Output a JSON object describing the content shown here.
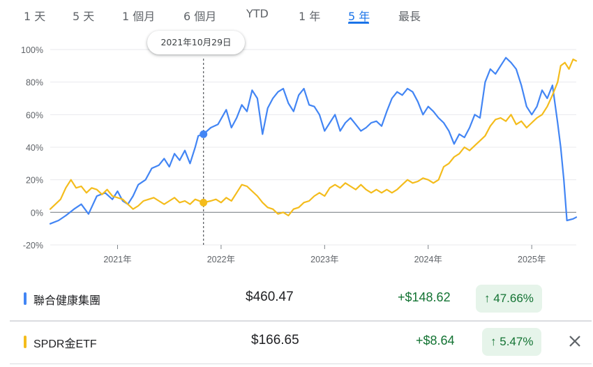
{
  "tabs": [
    {
      "label": "1 天",
      "active": false
    },
    {
      "label": "5 天",
      "active": false
    },
    {
      "label": "1 個月",
      "active": false
    },
    {
      "label": "6 個月",
      "active": false
    },
    {
      "label": "YTD",
      "active": false
    },
    {
      "label": "1 年",
      "active": false
    },
    {
      "label": "5 年",
      "active": true
    },
    {
      "label": "最長",
      "active": false
    }
  ],
  "tooltip_date": "2021年10月29日",
  "colors": {
    "series_a": "#4285f4",
    "series_b": "#f4bc1c",
    "accent": "#1a73e8",
    "gain": "#137333",
    "pill_bg": "#e6f4ea"
  },
  "chart_data": {
    "type": "line",
    "y_ticks": [
      "100%",
      "80%",
      "60%",
      "40%",
      "20%",
      "0%",
      "-20%"
    ],
    "ylim": [
      -20,
      100
    ],
    "x_ticks": [
      "2021年",
      "2022年",
      "2023年",
      "2024年",
      "2025年"
    ],
    "xlim": [
      2020.35,
      2025.43
    ],
    "grid": true,
    "hover_marker": {
      "x": 2021.83,
      "values": [
        48,
        6
      ]
    },
    "series": [
      {
        "color": "#4285f4",
        "points": [
          [
            2020.35,
            -7
          ],
          [
            2020.43,
            -5
          ],
          [
            2020.5,
            -2
          ],
          [
            2020.58,
            2
          ],
          [
            2020.65,
            5
          ],
          [
            2020.72,
            -1
          ],
          [
            2020.8,
            10
          ],
          [
            2020.88,
            12
          ],
          [
            2020.95,
            8
          ],
          [
            2021.0,
            13
          ],
          [
            2021.05,
            7
          ],
          [
            2021.1,
            5
          ],
          [
            2021.15,
            10
          ],
          [
            2021.2,
            17
          ],
          [
            2021.27,
            20
          ],
          [
            2021.33,
            27
          ],
          [
            2021.4,
            29
          ],
          [
            2021.45,
            33
          ],
          [
            2021.5,
            28
          ],
          [
            2021.55,
            36
          ],
          [
            2021.6,
            32
          ],
          [
            2021.65,
            38
          ],
          [
            2021.7,
            30
          ],
          [
            2021.75,
            40
          ],
          [
            2021.78,
            47
          ],
          [
            2021.83,
            48
          ],
          [
            2021.9,
            52
          ],
          [
            2021.97,
            54
          ],
          [
            2022.05,
            63
          ],
          [
            2022.1,
            52
          ],
          [
            2022.15,
            58
          ],
          [
            2022.2,
            66
          ],
          [
            2022.25,
            62
          ],
          [
            2022.3,
            75
          ],
          [
            2022.35,
            70
          ],
          [
            2022.4,
            48
          ],
          [
            2022.45,
            64
          ],
          [
            2022.5,
            70
          ],
          [
            2022.55,
            74
          ],
          [
            2022.6,
            76
          ],
          [
            2022.65,
            67
          ],
          [
            2022.7,
            62
          ],
          [
            2022.75,
            72
          ],
          [
            2022.8,
            76
          ],
          [
            2022.85,
            66
          ],
          [
            2022.9,
            65
          ],
          [
            2022.95,
            60
          ],
          [
            2023.0,
            50
          ],
          [
            2023.05,
            55
          ],
          [
            2023.1,
            60
          ],
          [
            2023.15,
            50
          ],
          [
            2023.2,
            55
          ],
          [
            2023.25,
            58
          ],
          [
            2023.3,
            54
          ],
          [
            2023.35,
            50
          ],
          [
            2023.4,
            52
          ],
          [
            2023.45,
            55
          ],
          [
            2023.5,
            56
          ],
          [
            2023.55,
            53
          ],
          [
            2023.6,
            62
          ],
          [
            2023.65,
            70
          ],
          [
            2023.7,
            74
          ],
          [
            2023.75,
            72
          ],
          [
            2023.8,
            76
          ],
          [
            2023.85,
            74
          ],
          [
            2023.9,
            68
          ],
          [
            2023.95,
            60
          ],
          [
            2024.0,
            65
          ],
          [
            2024.05,
            62
          ],
          [
            2024.1,
            58
          ],
          [
            2024.15,
            55
          ],
          [
            2024.2,
            50
          ],
          [
            2024.25,
            42
          ],
          [
            2024.3,
            48
          ],
          [
            2024.35,
            46
          ],
          [
            2024.4,
            52
          ],
          [
            2024.45,
            60
          ],
          [
            2024.5,
            58
          ],
          [
            2024.55,
            80
          ],
          [
            2024.6,
            88
          ],
          [
            2024.65,
            85
          ],
          [
            2024.7,
            90
          ],
          [
            2024.75,
            95
          ],
          [
            2024.8,
            92
          ],
          [
            2024.85,
            88
          ],
          [
            2024.9,
            78
          ],
          [
            2024.95,
            65
          ],
          [
            2025.0,
            60
          ],
          [
            2025.05,
            65
          ],
          [
            2025.1,
            75
          ],
          [
            2025.15,
            70
          ],
          [
            2025.2,
            78
          ],
          [
            2025.25,
            55
          ],
          [
            2025.28,
            40
          ],
          [
            2025.31,
            20
          ],
          [
            2025.34,
            -5
          ],
          [
            2025.4,
            -4
          ],
          [
            2025.43,
            -3
          ]
        ]
      },
      {
        "color": "#f4bc1c",
        "points": [
          [
            2020.35,
            2
          ],
          [
            2020.45,
            8
          ],
          [
            2020.5,
            15
          ],
          [
            2020.55,
            20
          ],
          [
            2020.6,
            15
          ],
          [
            2020.65,
            16
          ],
          [
            2020.7,
            12
          ],
          [
            2020.75,
            15
          ],
          [
            2020.8,
            14
          ],
          [
            2020.85,
            11
          ],
          [
            2020.9,
            14
          ],
          [
            2020.95,
            10
          ],
          [
            2021.0,
            9
          ],
          [
            2021.05,
            8
          ],
          [
            2021.1,
            5
          ],
          [
            2021.15,
            2
          ],
          [
            2021.2,
            4
          ],
          [
            2021.25,
            7
          ],
          [
            2021.3,
            8
          ],
          [
            2021.35,
            9
          ],
          [
            2021.4,
            7
          ],
          [
            2021.45,
            5
          ],
          [
            2021.5,
            7
          ],
          [
            2021.55,
            9
          ],
          [
            2021.6,
            6
          ],
          [
            2021.65,
            7
          ],
          [
            2021.7,
            5
          ],
          [
            2021.75,
            8
          ],
          [
            2021.83,
            6
          ],
          [
            2021.9,
            7
          ],
          [
            2021.95,
            8
          ],
          [
            2022.0,
            6
          ],
          [
            2022.05,
            9
          ],
          [
            2022.1,
            7
          ],
          [
            2022.15,
            12
          ],
          [
            2022.2,
            17
          ],
          [
            2022.25,
            16
          ],
          [
            2022.3,
            13
          ],
          [
            2022.35,
            10
          ],
          [
            2022.4,
            6
          ],
          [
            2022.45,
            3
          ],
          [
            2022.5,
            2
          ],
          [
            2022.55,
            -1
          ],
          [
            2022.6,
            0
          ],
          [
            2022.65,
            -2
          ],
          [
            2022.7,
            2
          ],
          [
            2022.75,
            3
          ],
          [
            2022.8,
            6
          ],
          [
            2022.85,
            7
          ],
          [
            2022.9,
            10
          ],
          [
            2022.95,
            12
          ],
          [
            2023.0,
            10
          ],
          [
            2023.05,
            15
          ],
          [
            2023.1,
            17
          ],
          [
            2023.15,
            15
          ],
          [
            2023.2,
            18
          ],
          [
            2023.25,
            16
          ],
          [
            2023.3,
            14
          ],
          [
            2023.35,
            17
          ],
          [
            2023.4,
            14
          ],
          [
            2023.45,
            12
          ],
          [
            2023.5,
            14
          ],
          [
            2023.55,
            12
          ],
          [
            2023.6,
            14
          ],
          [
            2023.65,
            12
          ],
          [
            2023.7,
            14
          ],
          [
            2023.75,
            17
          ],
          [
            2023.8,
            20
          ],
          [
            2023.85,
            18
          ],
          [
            2023.9,
            19
          ],
          [
            2023.95,
            21
          ],
          [
            2024.0,
            20
          ],
          [
            2024.05,
            18
          ],
          [
            2024.1,
            20
          ],
          [
            2024.15,
            28
          ],
          [
            2024.2,
            30
          ],
          [
            2024.25,
            34
          ],
          [
            2024.3,
            36
          ],
          [
            2024.35,
            40
          ],
          [
            2024.4,
            38
          ],
          [
            2024.45,
            41
          ],
          [
            2024.5,
            44
          ],
          [
            2024.55,
            47
          ],
          [
            2024.6,
            53
          ],
          [
            2024.65,
            57
          ],
          [
            2024.7,
            58
          ],
          [
            2024.75,
            56
          ],
          [
            2024.8,
            60
          ],
          [
            2024.85,
            54
          ],
          [
            2024.9,
            56
          ],
          [
            2024.95,
            52
          ],
          [
            2025.0,
            55
          ],
          [
            2025.05,
            58
          ],
          [
            2025.1,
            60
          ],
          [
            2025.15,
            65
          ],
          [
            2025.2,
            72
          ],
          [
            2025.25,
            80
          ],
          [
            2025.28,
            90
          ],
          [
            2025.32,
            92
          ],
          [
            2025.36,
            88
          ],
          [
            2025.4,
            94
          ],
          [
            2025.43,
            93
          ]
        ]
      }
    ]
  },
  "holdings": [
    {
      "name": "聯合健康集團",
      "price": "$460.47",
      "change": "+$148.62",
      "pct": "47.66%",
      "color": "#4285f4"
    },
    {
      "name": "SPDR金ETF",
      "price": "$166.65",
      "change": "+$8.64",
      "pct": "5.47%",
      "color": "#f4bc1c"
    }
  ],
  "up_arrow": "↑",
  "close_icon": "close-icon"
}
